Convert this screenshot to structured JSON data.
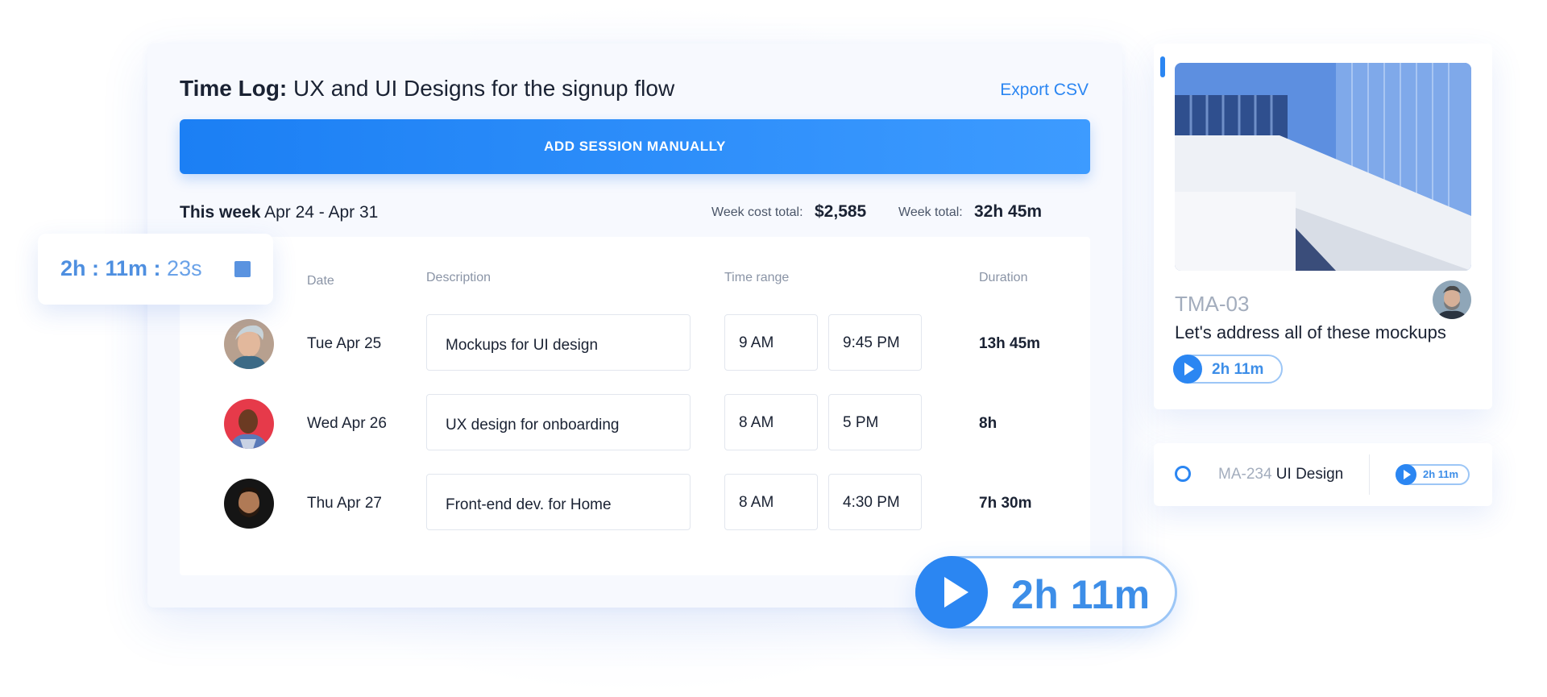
{
  "header": {
    "title_bold": "Time Log:",
    "title_rest": " UX and UI Designs for the signup flow",
    "export_label": "Export CSV",
    "add_session_label": "ADD SESSION MANUALLY"
  },
  "week": {
    "label": "This week",
    "range": " Apr 24 - Apr 31",
    "cost_label": "Week cost total:",
    "cost_value": "$2,585",
    "total_label": "Week total:",
    "total_value": "32h 45m"
  },
  "table": {
    "columns": {
      "date": "Date",
      "description": "Description",
      "time_range": "Time range",
      "duration": "Duration"
    },
    "rows": [
      {
        "date": "Tue Apr 25",
        "description": "Mockups for UI design",
        "start": "9 AM",
        "end": "9:45 PM",
        "duration": "13h 45m"
      },
      {
        "date": "Wed Apr 26",
        "description": "UX design for onboarding",
        "start": "8 AM",
        "end": "5 PM",
        "duration": "8h"
      },
      {
        "date": "Thu Apr 27",
        "description": "Front-end dev. for Home",
        "start": "8 AM",
        "end": "4:30 PM",
        "duration": "7h 30m"
      }
    ]
  },
  "timer": {
    "hours_minutes": "2h : 11m :",
    "seconds": " 23s",
    "stop_icon": "stop-square-icon"
  },
  "big_timer": {
    "label": "2h 11m",
    "icon": "play-icon"
  },
  "task_card": {
    "id": "TMA-03",
    "title": "Let's address all of these mockups",
    "timer_label": "2h 11m"
  },
  "mini_task": {
    "code": "MA-234",
    "name": " UI Design",
    "timer_label": "2h 11m"
  },
  "colors": {
    "accent": "#2b86f2",
    "accent_light": "#9cc6f6",
    "text_dark": "#1a2233",
    "text_muted": "#8a94a6"
  }
}
